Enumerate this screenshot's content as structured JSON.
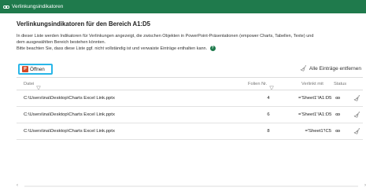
{
  "window": {
    "title": "Verlinkungsindikatoren"
  },
  "heading": "Verlinkungsindikatoren für den Bereich A1:D5",
  "description": {
    "line1": "In dieser Liste werden Indikatoren für Verlinkungen angezeigt, die zwischen Objekten in PowerPoint-Präsentationen (empower Charts, Tabellen, Texte) und",
    "line2": "dem ausgewählten Bereich bestehen könnten.",
    "line3": "Bitte beachten Sie, dass diese Liste ggf. nicht vollständig ist und verwaiste Einträge enthalten kann."
  },
  "toolbar": {
    "open_label": "Öffnen",
    "remove_all_label": "Alle Einträge entfernen"
  },
  "table": {
    "columns": {
      "file": "Datei",
      "slide": "Folien Nr.",
      "linked": "Verlinkt mit",
      "status": "Status"
    },
    "rows": [
      {
        "file": "C:\\Users\\ina\\Desktop\\Charts Excel Link.pptx",
        "slide": "4",
        "linked": "='Sheet1'!A1:D5"
      },
      {
        "file": "C:\\Users\\ina\\Desktop\\Charts Excel Link.pptx",
        "slide": "6",
        "linked": "='Sheet1'!A1:D5"
      },
      {
        "file": "C:\\Users\\ina\\Desktop\\Charts Excel Link.pptx",
        "slide": "8",
        "linked": "='Sheet1'!C5"
      }
    ]
  },
  "icons": {
    "title": "link-icon",
    "open": "powerpoint-icon",
    "remove_all": "broom-icon",
    "status": "link-status-icon",
    "row_action": "broom-icon",
    "help": "help-icon"
  },
  "colors": {
    "titlebar": "#1f7a4c",
    "highlight": "#29b6e8",
    "ppt": "#d24726"
  }
}
